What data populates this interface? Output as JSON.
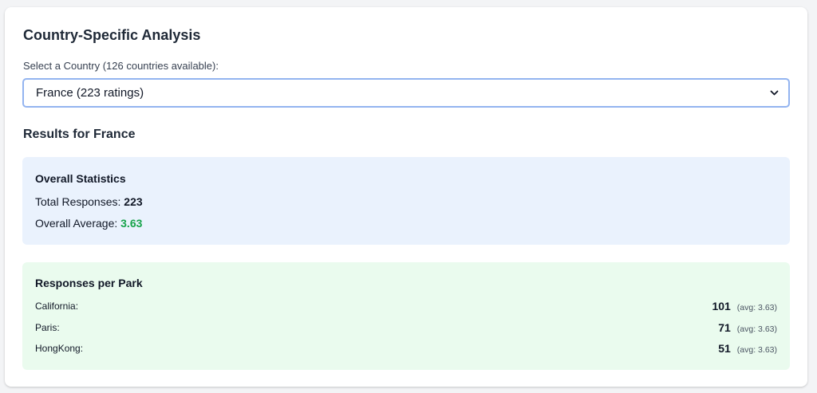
{
  "section_title": "Country-Specific Analysis",
  "select": {
    "label": "Select a Country (126 countries available):",
    "value": "France (223 ratings)"
  },
  "results_title": "Results for France",
  "overall": {
    "heading": "Overall Statistics",
    "total_label": "Total Responses:",
    "total_value": "223",
    "average_label": "Overall Average:",
    "average_value": "3.63"
  },
  "parks": {
    "heading": "Responses per Park",
    "rows": [
      {
        "name": "California:",
        "count": "101",
        "avg": "(avg: 3.63)"
      },
      {
        "name": "Paris:",
        "count": "71",
        "avg": "(avg: 3.63)"
      },
      {
        "name": "HongKong:",
        "count": "51",
        "avg": "(avg: 3.63)"
      }
    ]
  },
  "colors": {
    "accent_border": "#93b4f0",
    "stats_bg": "#eaf2fd",
    "parks_bg": "#eafbee",
    "average_green": "#16a34a"
  },
  "icons": {
    "select_chevron": "chevron-down-icon"
  }
}
